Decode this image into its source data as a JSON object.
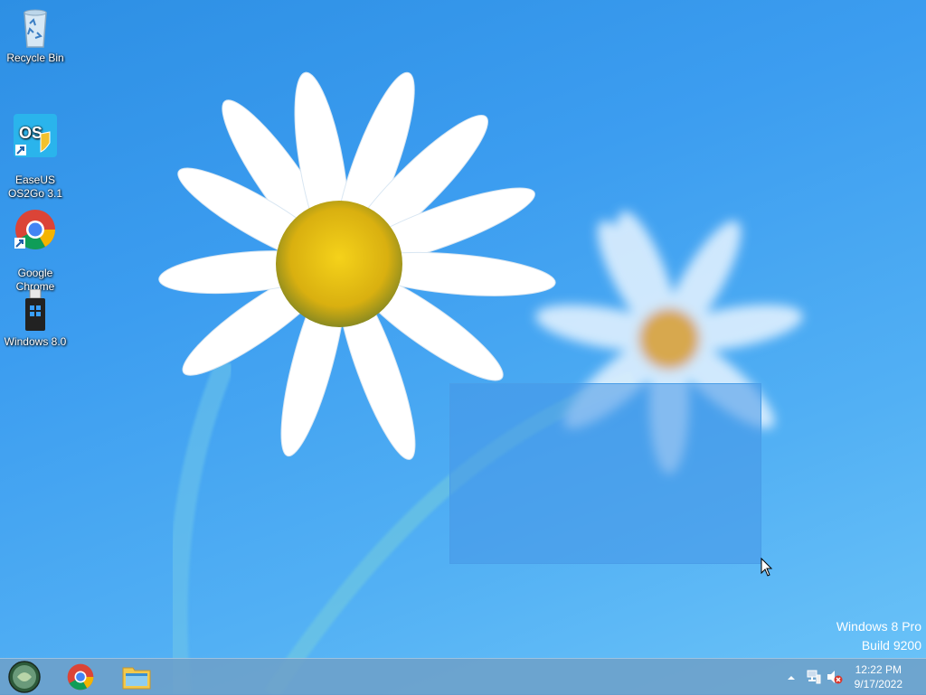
{
  "desktop": {
    "icons": [
      {
        "label": "Recycle Bin",
        "icon": "recycle-bin-icon"
      },
      {
        "label": "EaseUS\nOS2Go 3.1",
        "icon": "easeus-os2go-icon"
      },
      {
        "label": "Google\nChrome",
        "icon": "chrome-icon"
      },
      {
        "label": "Windows 8.0",
        "icon": "windows-usb-icon"
      }
    ]
  },
  "watermark": {
    "line1": "Windows 8 Pro",
    "line2": "Build 9200"
  },
  "taskbar": {
    "pinned": [
      {
        "name": "start-orb",
        "icon": "start-orb-icon"
      },
      {
        "name": "chrome",
        "icon": "chrome-icon"
      },
      {
        "name": "file-explorer",
        "icon": "folder-icon"
      }
    ],
    "tray": {
      "show_hidden_icon": "chevron-up-icon",
      "network_icon": "network-icon",
      "volume_icon": "volume-muted-icon",
      "time": "12:22 PM",
      "date": "9/17/2022"
    }
  },
  "colors": {
    "wallpaper_blue": "#3c9df0",
    "selection": "#4a9ee8",
    "taskbar": "#6ea0c8"
  }
}
